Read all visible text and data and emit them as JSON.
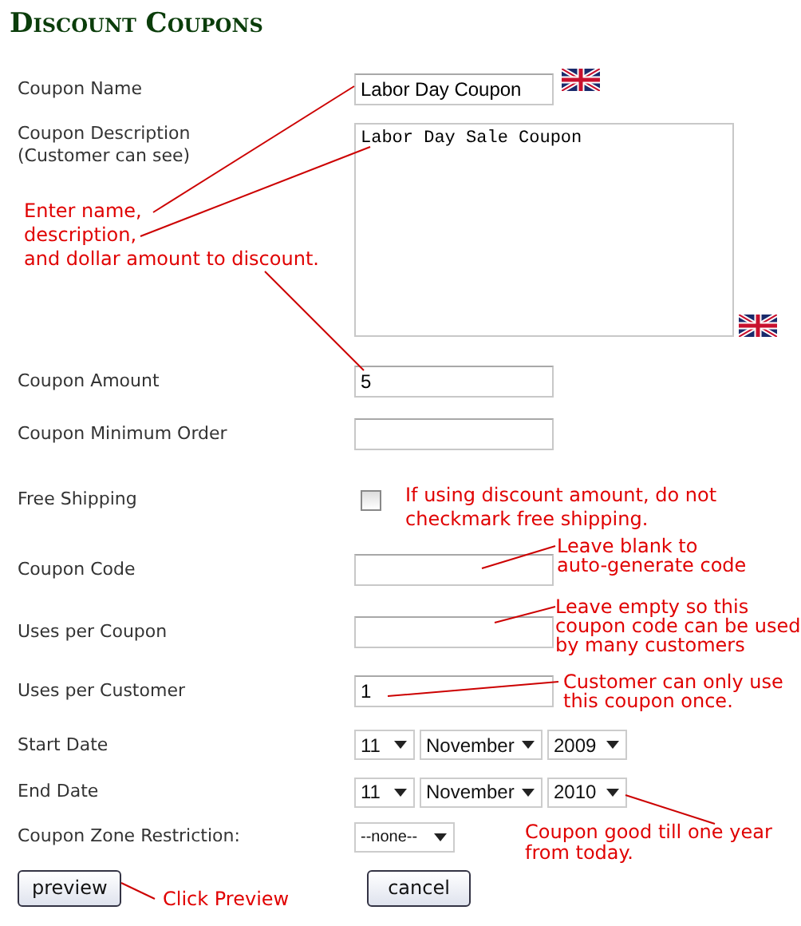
{
  "title": "Discount Coupons",
  "rows": [
    {
      "kind": "text",
      "label": "Coupon Name",
      "value": "Labor Day Coupon",
      "flag": true
    },
    {
      "kind": "textarea",
      "label": "Coupon Description\n(Customer can see)",
      "value": "Labor Day Sale Coupon",
      "flag": true
    },
    {
      "kind": "text",
      "label": "Coupon Amount",
      "value": "5"
    },
    {
      "kind": "text",
      "label": "Coupon Minimum Order"
    },
    {
      "kind": "checkbox",
      "label": "Free Shipping",
      "checked": false
    },
    {
      "kind": "text",
      "label": "Coupon Code"
    },
    {
      "kind": "text",
      "label": "Uses per Coupon"
    },
    {
      "kind": "text",
      "label": "Uses per Customer",
      "value": "1"
    },
    {
      "kind": "date",
      "label": "Start Date",
      "day": "11",
      "month": "November",
      "year": "2009"
    },
    {
      "kind": "date",
      "label": "End Date",
      "day": "11",
      "month": "November",
      "year": "2010"
    },
    {
      "kind": "select",
      "label": "Coupon Zone Restriction:",
      "value": "--none--"
    }
  ],
  "buttons": [
    "preview",
    "cancel"
  ],
  "notes": [
    "Enter name,\ndescription,\nand dollar amount to discount.",
    "If using discount amount, do not\ncheckmark free shipping.",
    "Leave blank to\nauto-generate code",
    "Leave empty so this\ncoupon code can be used\nby many customers",
    "Customer can only use\nthis coupon once.",
    "Coupon good till one year\nfrom today.",
    "Click Preview"
  ]
}
